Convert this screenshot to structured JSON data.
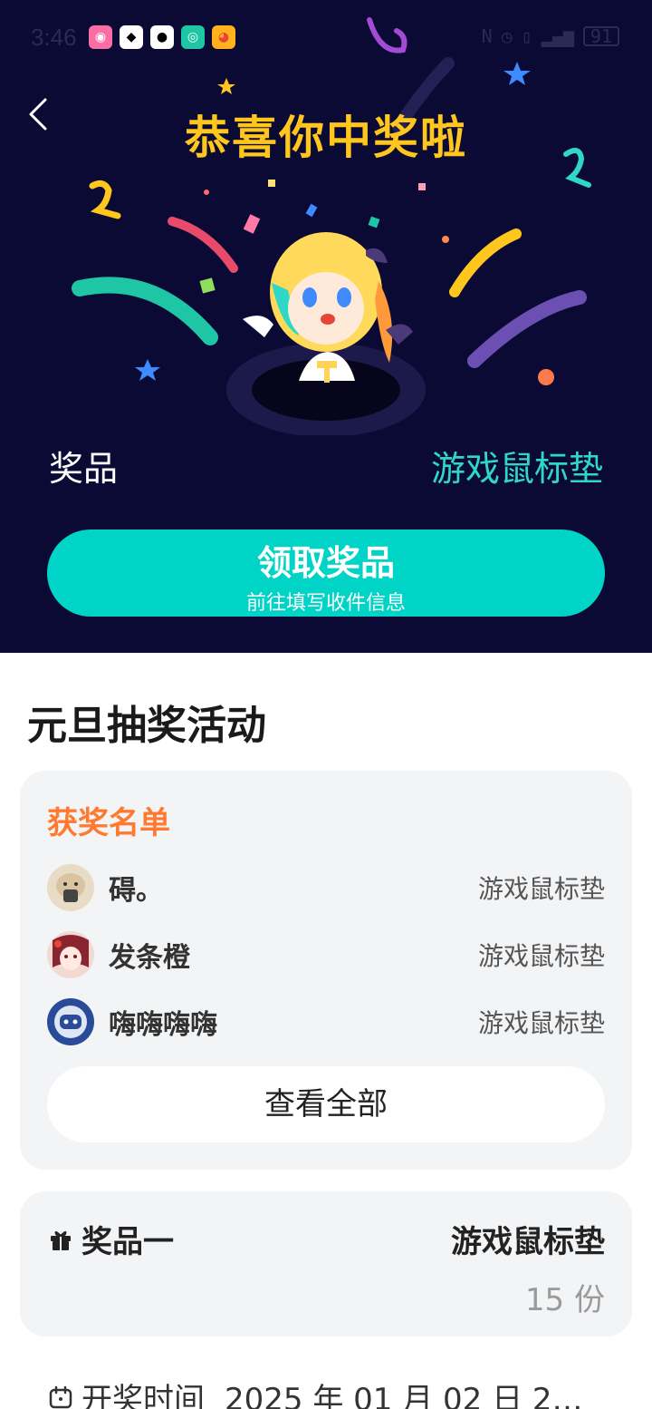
{
  "status_bar": {
    "time": "3:46",
    "battery": "91"
  },
  "hero": {
    "title": "恭喜你中奖啦",
    "prize_label": "奖品",
    "prize_value": "游戏鼠标垫",
    "claim_button": "领取奖品",
    "claim_subtext": "前往填写收件信息"
  },
  "activity": {
    "title": "元旦抽奖活动"
  },
  "winners": {
    "header": "获奖名单",
    "rows": [
      {
        "name": "碍。",
        "prize": "游戏鼠标垫"
      },
      {
        "name": "发条橙",
        "prize": "游戏鼠标垫"
      },
      {
        "name": "嗨嗨嗨嗨",
        "prize": "游戏鼠标垫"
      }
    ],
    "view_all": "查看全部"
  },
  "prize_info": {
    "label": "奖品一",
    "name": "游戏鼠标垫",
    "count": "15 份"
  },
  "draw_time": {
    "label": "开奖时间",
    "value": "2025 年 01 月 02 日 2…"
  },
  "colors": {
    "hero_bg": "#0b0a34",
    "title_yellow": "#ffc61e",
    "teal": "#00d4c6",
    "orange": "#ff7a2f"
  }
}
